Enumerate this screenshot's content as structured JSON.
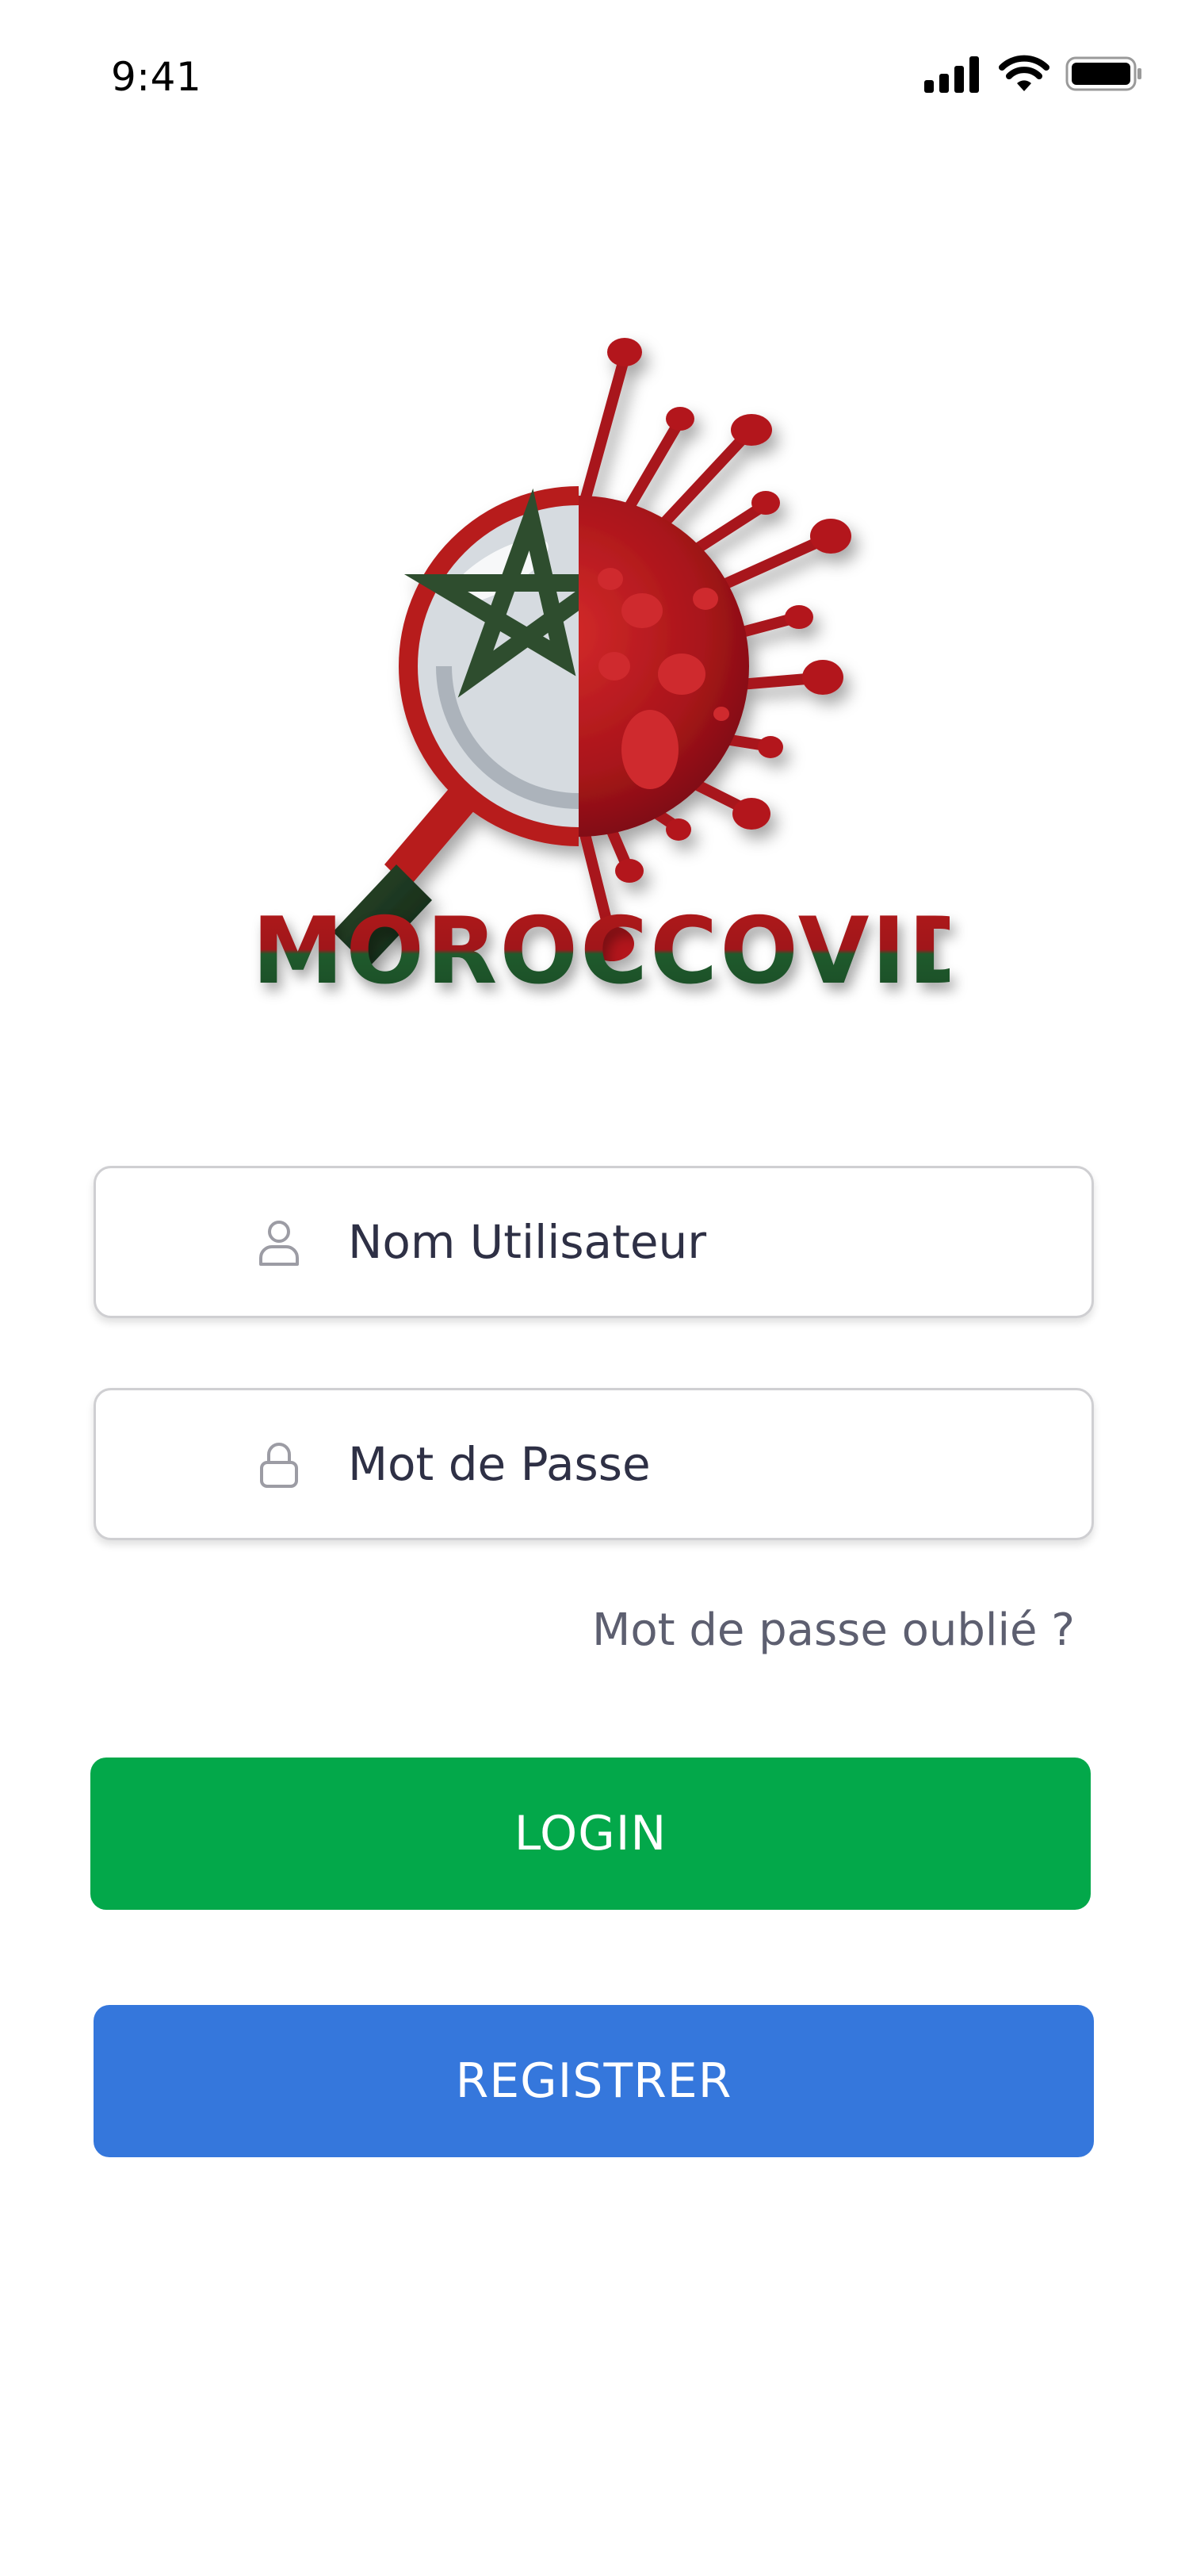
{
  "status_bar": {
    "time": "9:41",
    "signal_icon": "cellular-signal-icon",
    "wifi_icon": "wifi-icon",
    "battery_icon": "battery-icon"
  },
  "logo": {
    "icon": "magnifier-virus-flag-logo",
    "wordmark": "MOROCCOVID"
  },
  "form": {
    "username": {
      "icon": "user-icon",
      "placeholder": "Nom Utilisateur",
      "value": ""
    },
    "password": {
      "icon": "lock-icon",
      "placeholder": "Mot de Passe",
      "value": ""
    },
    "forgot_password": "Mot de passe oublié ?"
  },
  "buttons": {
    "login": "LOGIN",
    "register": "REGISTRER"
  },
  "colors": {
    "login_button": "#03a84a",
    "register_button": "#3577dc",
    "logo_red": "#b31a1a",
    "logo_green": "#1f5a2c"
  }
}
